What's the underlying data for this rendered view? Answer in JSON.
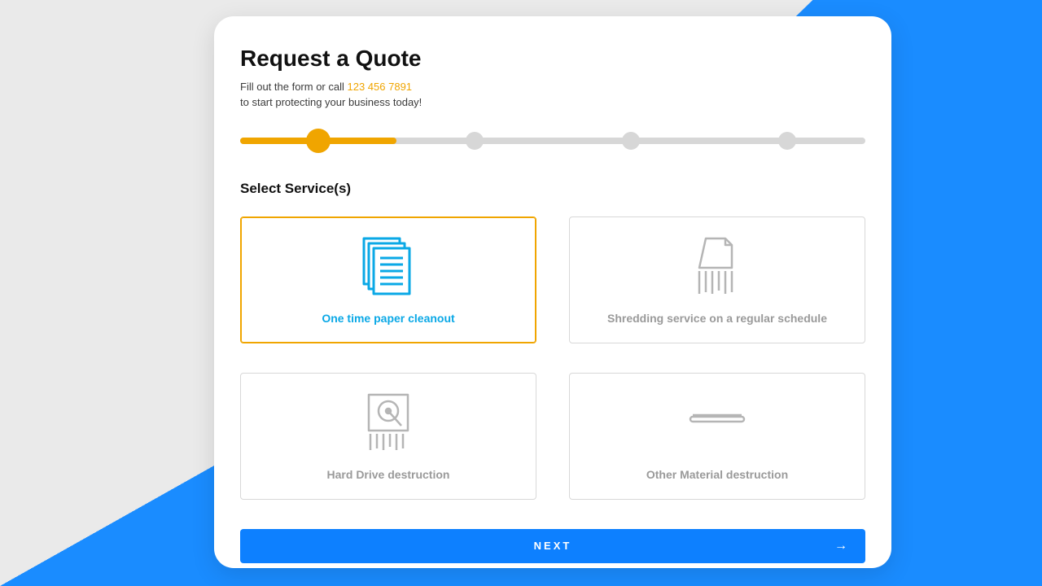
{
  "header": {
    "title": "Request a Quote",
    "subtitle_prefix": "Fill out the form or call ",
    "phone": "123 456 7891",
    "subtitle_line2": "to start protecting your business today!"
  },
  "stepper": {
    "current": 1,
    "total": 4
  },
  "section": {
    "title": "Select Service(s)"
  },
  "services": [
    {
      "label": "One time paper cleanout",
      "selected": true
    },
    {
      "label": "Shredding service on a regular schedule",
      "selected": false
    },
    {
      "label": "Hard Drive destruction",
      "selected": false
    },
    {
      "label": "Other Material destruction",
      "selected": false
    }
  ],
  "actions": {
    "next": "NEXT"
  },
  "colors": {
    "accent": "#f0a500",
    "primary": "#0d80ff",
    "highlight": "#0aa8e6"
  }
}
